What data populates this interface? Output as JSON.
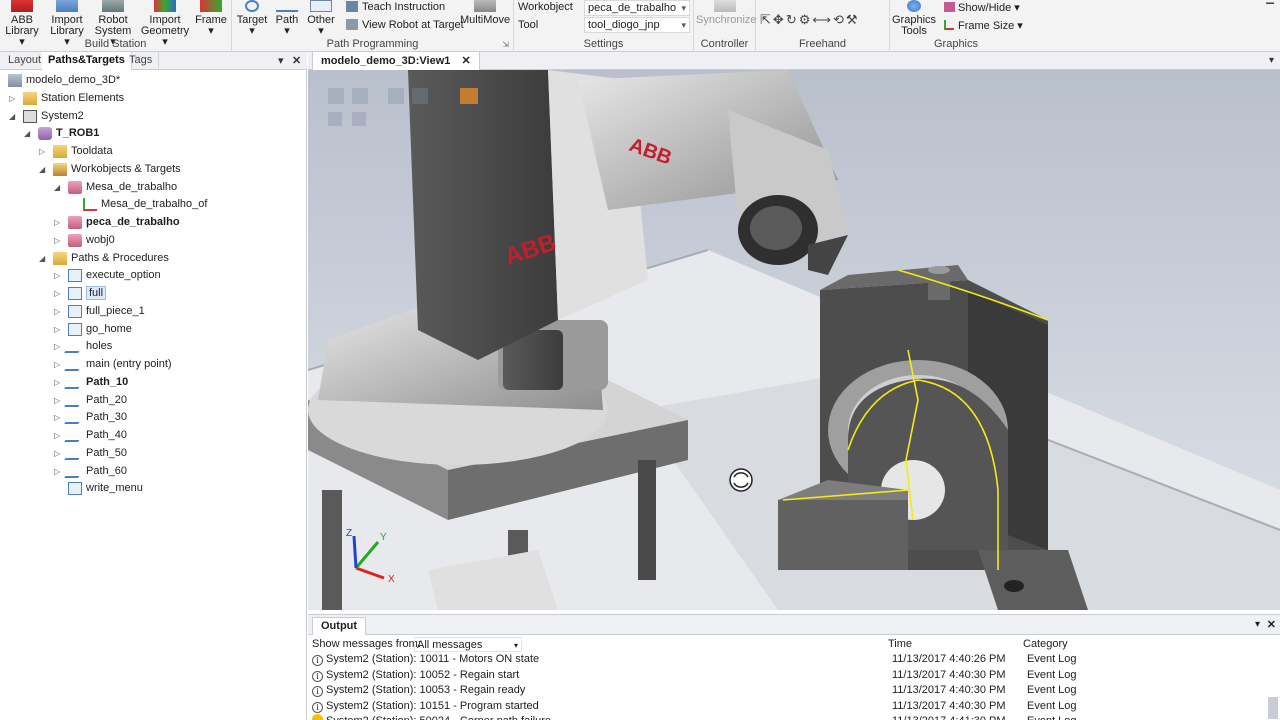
{
  "ribbon": {
    "build_station": {
      "label": "Build Station",
      "abb_library": [
        "ABB",
        "Library"
      ],
      "import_library": [
        "Import",
        "Library"
      ],
      "robot_system": [
        "Robot",
        "System"
      ],
      "import_geometry": [
        "Import",
        "Geometry"
      ],
      "frame": "Frame"
    },
    "path_programming": {
      "label": "Path Programming",
      "target": "Target",
      "path": "Path",
      "other": "Other",
      "teach_instruction": "Teach Instruction",
      "view_robot_at_target": "View Robot at Target",
      "multimove": "MultiMove"
    },
    "settings": {
      "label": "Settings",
      "workobject_label": "Workobject",
      "workobject_value": "peca_de_trabalho",
      "tool_label": "Tool",
      "tool_value": "tool_diogo_jnp"
    },
    "controller": {
      "label": "Controller",
      "synchronize": "Synchronize"
    },
    "freehand": {
      "label": "Freehand"
    },
    "graphics": {
      "label": "Graphics",
      "graphics_tools": [
        "Graphics",
        "Tools"
      ],
      "show_hide": "Show/Hide",
      "frame_size": "Frame Size"
    }
  },
  "left_panel": {
    "tabs": [
      "Layout",
      "Paths&Targets",
      "Tags"
    ],
    "active_tab": "Paths&Targets",
    "tree": [
      {
        "label": "modelo_demo_3D*",
        "indent": 0,
        "icon": "station-icon",
        "arrow": ""
      },
      {
        "label": "Station Elements",
        "indent": 1,
        "icon": "folder-icon",
        "arrow": "▷"
      },
      {
        "label": "System2",
        "indent": 1,
        "icon": "controller-icon",
        "arrow": "◢"
      },
      {
        "label": "T_ROB1",
        "indent": 2,
        "icon": "task-icon",
        "arrow": "◢",
        "bold": true
      },
      {
        "label": "Tooldata",
        "indent": 3,
        "icon": "folder-icon",
        "arrow": "▷"
      },
      {
        "label": "Workobjects & Targets",
        "indent": 3,
        "icon": "workobject-folder-icon",
        "arrow": "◢"
      },
      {
        "label": "Mesa_de_trabalho",
        "indent": 4,
        "icon": "workobject-icon",
        "arrow": "◢"
      },
      {
        "label": "Mesa_de_trabalho_of",
        "indent": 5,
        "icon": "frame-icon",
        "arrow": ""
      },
      {
        "label": "peca_de_trabalho",
        "indent": 4,
        "icon": "workobject-icon",
        "arrow": "▷",
        "bold": true
      },
      {
        "label": "wobj0",
        "indent": 4,
        "icon": "workobject-icon",
        "arrow": "▷"
      },
      {
        "label": "Paths & Procedures",
        "indent": 3,
        "icon": "folder-icon",
        "arrow": "◢"
      },
      {
        "label": "execute_option",
        "indent": 4,
        "icon": "procedure-icon",
        "arrow": "▷"
      },
      {
        "label": "full",
        "indent": 4,
        "icon": "procedure-icon",
        "arrow": "▷",
        "selected": true
      },
      {
        "label": "full_piece_1",
        "indent": 4,
        "icon": "procedure-icon",
        "arrow": "▷"
      },
      {
        "label": "go_home",
        "indent": 4,
        "icon": "procedure-icon",
        "arrow": "▷"
      },
      {
        "label": "holes",
        "indent": 4,
        "icon": "path-icon",
        "arrow": "▷"
      },
      {
        "label": "main (entry point)",
        "indent": 4,
        "icon": "path-icon",
        "arrow": "▷"
      },
      {
        "label": "Path_10",
        "indent": 4,
        "icon": "path-icon",
        "arrow": "▷",
        "bold": true
      },
      {
        "label": "Path_20",
        "indent": 4,
        "icon": "path-icon",
        "arrow": "▷"
      },
      {
        "label": "Path_30",
        "indent": 4,
        "icon": "path-icon",
        "arrow": "▷"
      },
      {
        "label": "Path_40",
        "indent": 4,
        "icon": "path-icon",
        "arrow": "▷"
      },
      {
        "label": "Path_50",
        "indent": 4,
        "icon": "path-icon",
        "arrow": "▷"
      },
      {
        "label": "Path_60",
        "indent": 4,
        "icon": "path-icon",
        "arrow": "▷"
      },
      {
        "label": "write_menu",
        "indent": 4,
        "icon": "procedure-icon",
        "arrow": ""
      }
    ]
  },
  "viewport": {
    "tab_title": "modelo_demo_3D:View1",
    "brand_text": "ABB",
    "axes": {
      "x": "X",
      "y": "Y",
      "z": "Z"
    }
  },
  "output": {
    "tab_title": "Output",
    "filter_label": "Show messages from:",
    "filter_value": "All messages",
    "col_time": "Time",
    "col_category": "Category",
    "rows": [
      {
        "message": "System2 (Station): 10011 - Motors ON state",
        "time": "11/13/2017 4:40:26 PM",
        "category": "Event Log",
        "level": "info"
      },
      {
        "message": "System2 (Station): 10052 - Regain start",
        "time": "11/13/2017 4:40:30 PM",
        "category": "Event Log",
        "level": "info"
      },
      {
        "message": "System2 (Station): 10053 - Regain ready",
        "time": "11/13/2017 4:40:30 PM",
        "category": "Event Log",
        "level": "info"
      },
      {
        "message": "System2 (Station): 10151 - Program started",
        "time": "11/13/2017 4:40:30 PM",
        "category": "Event Log",
        "level": "info"
      },
      {
        "message": "System2 (Station): 50024 - Corner path failure",
        "time": "11/13/2017 4:41:30 PM",
        "category": "Event Log",
        "level": "warning"
      }
    ]
  }
}
